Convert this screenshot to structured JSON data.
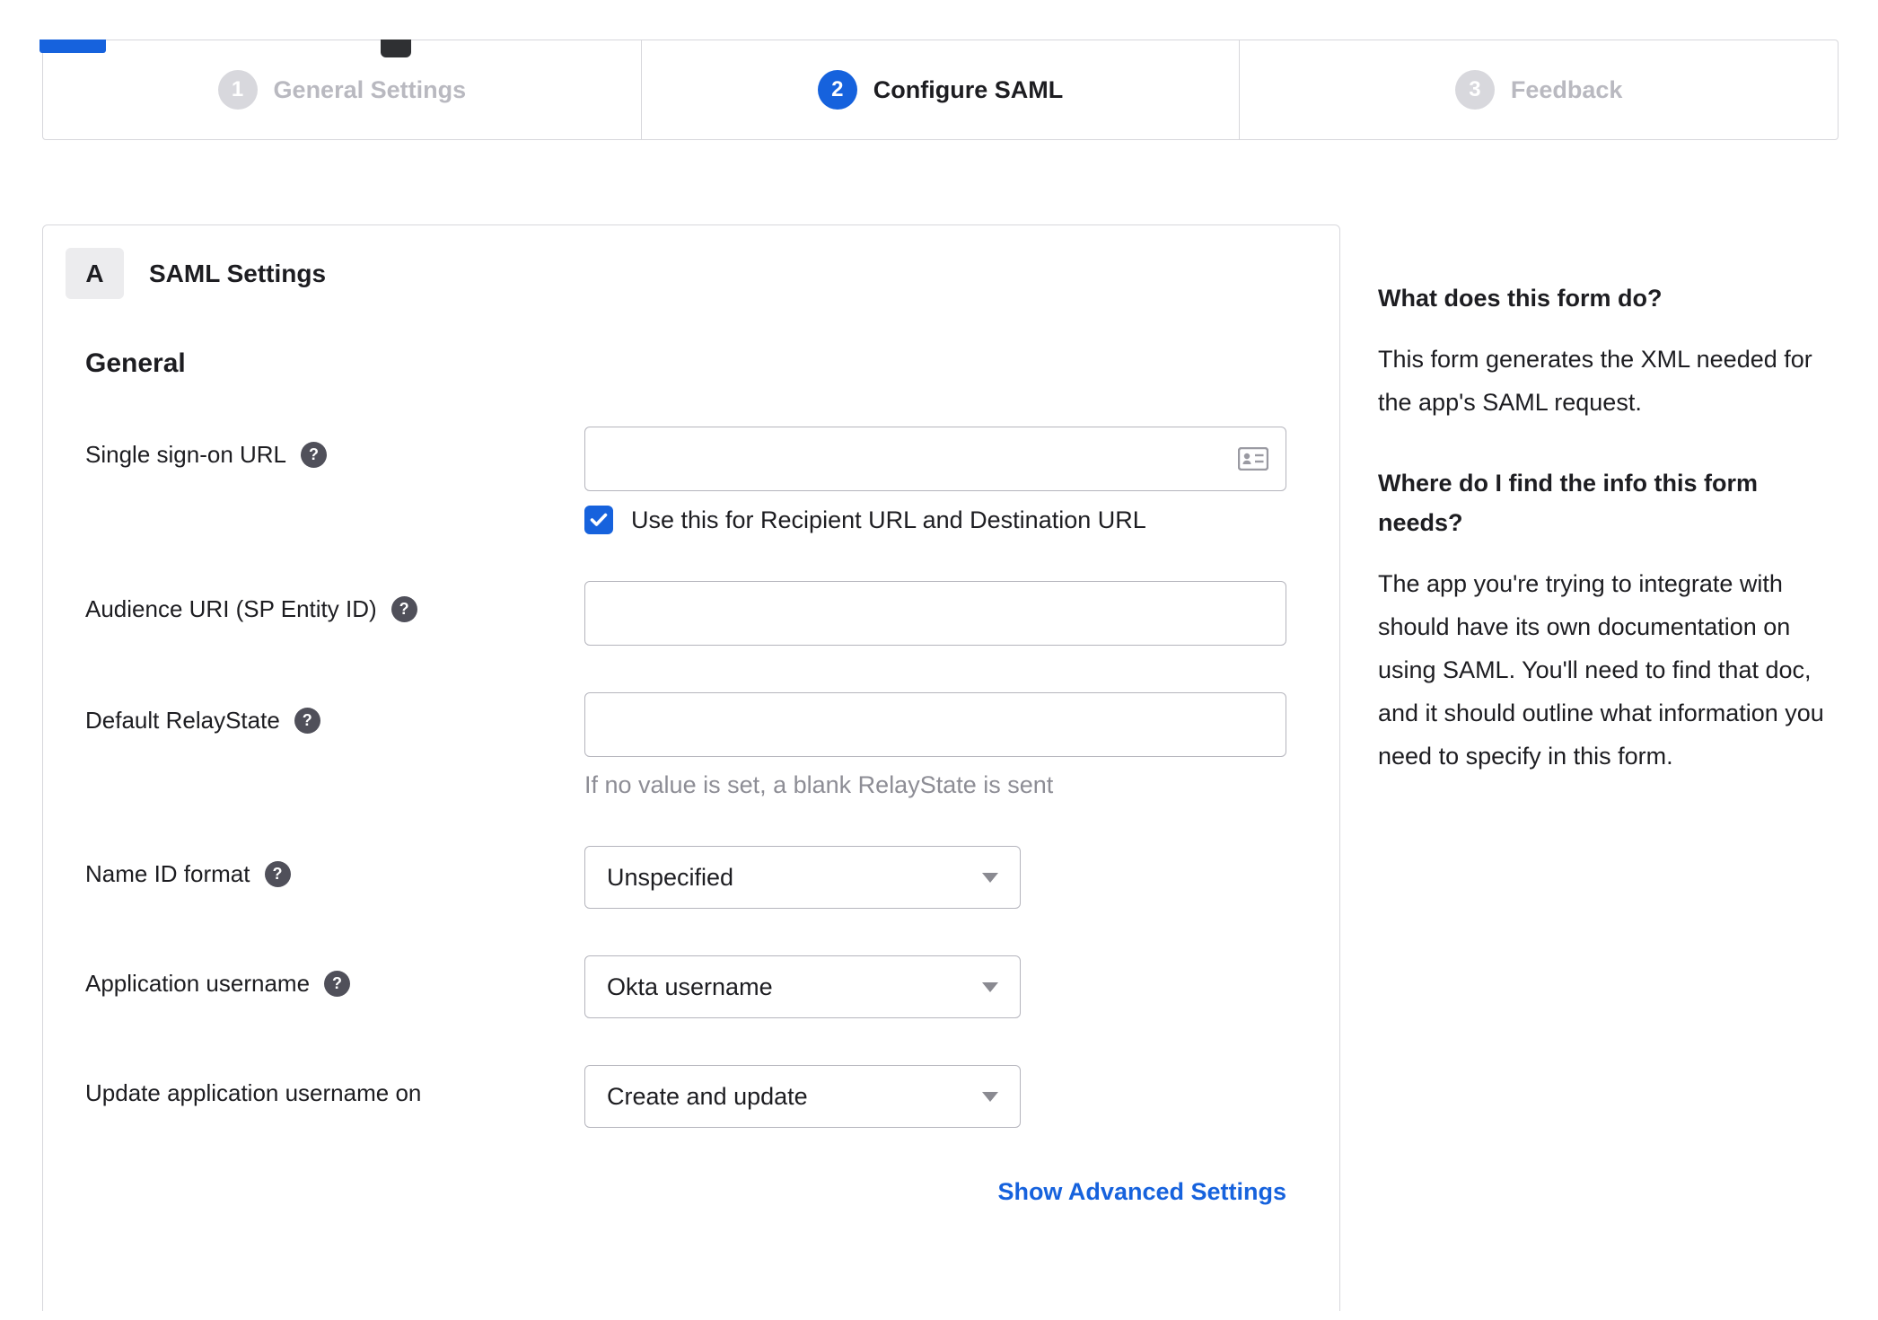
{
  "stepper": {
    "steps": [
      {
        "number": "1",
        "label": "General Settings",
        "state": "inactive"
      },
      {
        "number": "2",
        "label": "Configure SAML",
        "state": "active"
      },
      {
        "number": "3",
        "label": "Feedback",
        "state": "inactive"
      }
    ]
  },
  "panel": {
    "badge": "A",
    "title": "SAML Settings",
    "section": "General",
    "sso": {
      "label": "Single sign-on URL",
      "value": "",
      "checkbox_label": "Use this for Recipient URL and Destination URL",
      "checked": true
    },
    "audience": {
      "label": "Audience URI (SP Entity ID)",
      "value": ""
    },
    "relaystate": {
      "label": "Default RelayState",
      "value": "",
      "hint": "If no value is set, a blank RelayState is sent"
    },
    "nameid": {
      "label": "Name ID format",
      "value": "Unspecified"
    },
    "appusername": {
      "label": "Application username",
      "value": "Okta username"
    },
    "updateusername": {
      "label": "Update application username on",
      "value": "Create and update"
    },
    "advanced_link": "Show Advanced Settings",
    "help_glyph": "?"
  },
  "sidebar": {
    "sections": [
      {
        "heading": "What does this form do?",
        "body": "This form generates the XML needed for the app's SAML request."
      },
      {
        "heading": "Where do I find the info this form needs?",
        "body": "The app you're trying to integrate with should have its own documentation on using SAML. You'll need to find that doc, and it should outline what information you need to specify in this form."
      }
    ]
  },
  "colors": {
    "accent": "#1662dd",
    "inactive": "#d8d8dd",
    "border": "#d7d7dc"
  }
}
